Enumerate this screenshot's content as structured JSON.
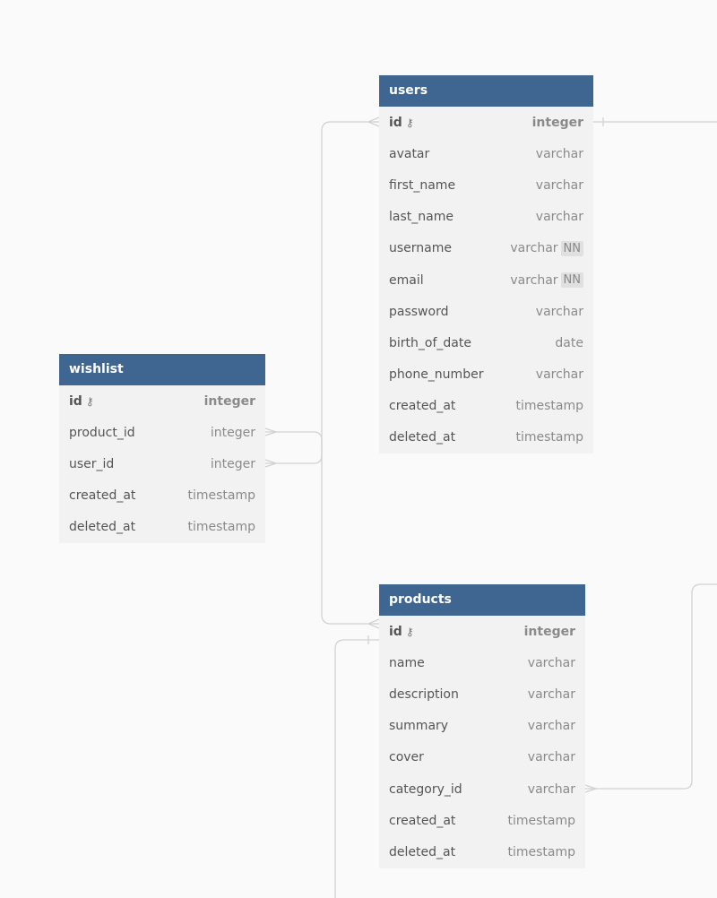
{
  "tables": {
    "users": {
      "name": "users",
      "columns": [
        {
          "name": "id",
          "type": "integer",
          "pk": true
        },
        {
          "name": "avatar",
          "type": "varchar"
        },
        {
          "name": "first_name",
          "type": "varchar"
        },
        {
          "name": "last_name",
          "type": "varchar"
        },
        {
          "name": "username",
          "type": "varchar",
          "badge": "NN"
        },
        {
          "name": "email",
          "type": "varchar",
          "badge": "NN"
        },
        {
          "name": "password",
          "type": "varchar"
        },
        {
          "name": "birth_of_date",
          "type": "date"
        },
        {
          "name": "phone_number",
          "type": "varchar"
        },
        {
          "name": "created_at",
          "type": "timestamp"
        },
        {
          "name": "deleted_at",
          "type": "timestamp"
        }
      ]
    },
    "wishlist": {
      "name": "wishlist",
      "columns": [
        {
          "name": "id",
          "type": "integer",
          "pk": true
        },
        {
          "name": "product_id",
          "type": "integer"
        },
        {
          "name": "user_id",
          "type": "integer"
        },
        {
          "name": "created_at",
          "type": "timestamp"
        },
        {
          "name": "deleted_at",
          "type": "timestamp"
        }
      ]
    },
    "products": {
      "name": "products",
      "columns": [
        {
          "name": "id",
          "type": "integer",
          "pk": true
        },
        {
          "name": "name",
          "type": "varchar"
        },
        {
          "name": "description",
          "type": "varchar"
        },
        {
          "name": "summary",
          "type": "varchar"
        },
        {
          "name": "cover",
          "type": "varchar"
        },
        {
          "name": "category_id",
          "type": "varchar"
        },
        {
          "name": "created_at",
          "type": "timestamp"
        },
        {
          "name": "deleted_at",
          "type": "timestamp"
        }
      ]
    }
  },
  "relationships": [
    {
      "from": "wishlist.user_id",
      "to": "users.id",
      "cardinality": "many-to-one"
    },
    {
      "from": "wishlist.product_id",
      "to": "products.id",
      "cardinality": "many-to-one"
    },
    {
      "from": "products.category_id",
      "to": "categories.id",
      "cardinality": "many-to-one"
    },
    {
      "from": "users.id",
      "to": "offscreen",
      "cardinality": "one"
    },
    {
      "from": "products.id",
      "to": "offscreen",
      "cardinality": "one"
    }
  ]
}
